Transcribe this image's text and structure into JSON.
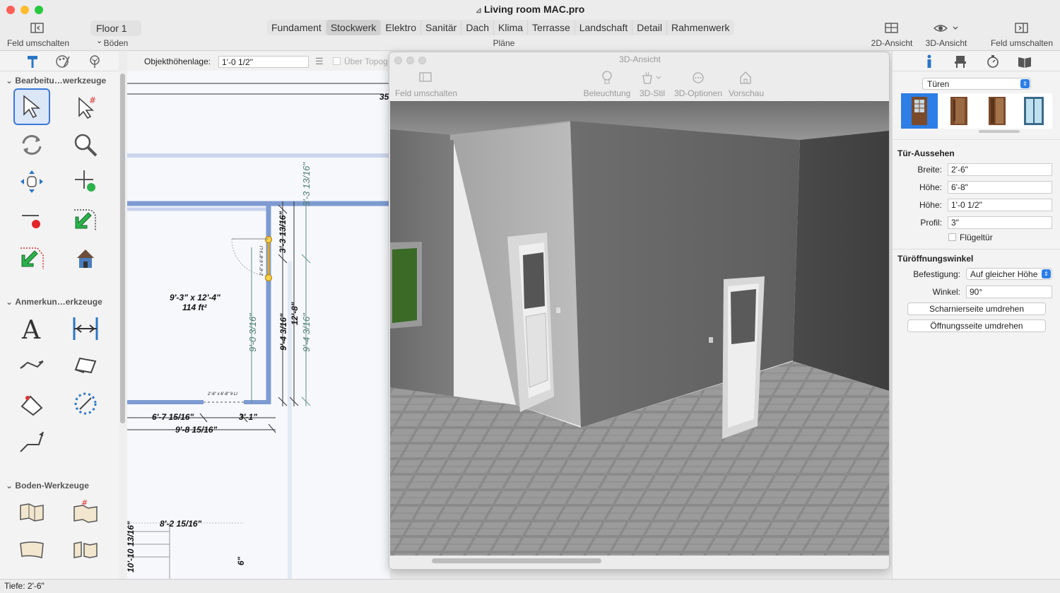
{
  "window": {
    "title": "Living room MAC.pro"
  },
  "toolbar": {
    "toggle_left": "Feld umschalten",
    "floor_select": "Floor 1",
    "floors_label": "Böden",
    "plans_label": "Pläne",
    "tabs": [
      "Fundament",
      "Stockwerk",
      "Elektro",
      "Sanitär",
      "Dach",
      "Klima",
      "Terrasse",
      "Landschaft",
      "Detail",
      "Rahmenwerk"
    ],
    "active_tab": "Stockwerk",
    "view2d": "2D-Ansicht",
    "view3d": "3D-Ansicht",
    "toggle_right": "Feld umschalten"
  },
  "left_panel": {
    "sections": [
      "Bearbeitu…werkzeuge",
      "Anmerkun…erkzeuge",
      "Boden-Werkzeuge"
    ]
  },
  "plan_toolbar": {
    "height_label": "Objekthöhenlage:",
    "height_value": "1'-0 1/2\"",
    "checkbox_label": "Über Topog"
  },
  "plan": {
    "dims": {
      "top": "35",
      "room_size": "9'-3\" x 12'-4\"",
      "room_area": "114 ft²",
      "v1": "3'-3 13/16\"",
      "v2": "3'-3 13/16\"",
      "v3": "9'-0 3/16\"",
      "v4": "9'-4 3/16\"",
      "v5": "12'-8\"",
      "v6": "9'-4 3/16\"",
      "h1": "6'-7 15/16\"",
      "h2": "3'-1\"",
      "h3": "9'-8 15/16\"",
      "h4": "8'-2 15/16\"",
      "side": "10'-10 13/16\"",
      "bottom": "6\"",
      "door_label_small": "2'-6\" x 6'-8\" 9 LI",
      "door_label_small2": "2'-6\" x 6'-8\" 9 LI"
    }
  },
  "view3d": {
    "title": "3D-Ansicht",
    "toggle": "Feld umschalten",
    "lighting": "Beleuchtung",
    "style": "3D-Stil",
    "options": "3D-Optionen",
    "preview": "Vorschau"
  },
  "right_panel": {
    "category": "Türen",
    "section1": "Tür-Aussehen",
    "width_label": "Breite:",
    "width_value": "2'-6\"",
    "height_label": "Höhe:",
    "height_value": "6'-8\"",
    "height2_label": "Höhe:",
    "height2_value": "1'-0 1/2\"",
    "profile_label": "Profil:",
    "profile_value": "3\"",
    "wing_label": "Flügeltür",
    "section2": "Türöffnungswinkel",
    "attach_label": "Befestigung:",
    "attach_value": "Auf gleicher Höhe",
    "angle_label": "Winkel:",
    "angle_value": "90°",
    "btn_hinge": "Scharnierseite umdrehen",
    "btn_open": "Öffnungsseite umdrehen"
  },
  "status": {
    "depth_label": "Tiefe:",
    "depth_value": "2'-6\""
  }
}
